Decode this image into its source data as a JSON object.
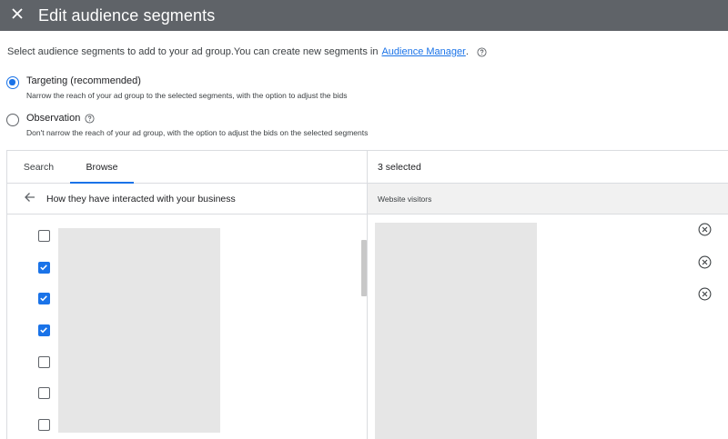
{
  "header": {
    "close_icon": "close-icon",
    "title": "Edit audience segments",
    "background": "#5f6368"
  },
  "intro": {
    "text": "Select audience segments to add to your ad group.You can create new segments in",
    "link": "Audience Manager",
    "suffix": ".",
    "help_icon": "help-icon"
  },
  "options": [
    {
      "label": "Targeting (recommended)",
      "description": "Narrow the reach of your ad group to the selected segments, with the option to adjust the bids",
      "selected": true
    },
    {
      "label": "Observation",
      "description": "Don't narrow the reach of your ad group, with the option to adjust the bids on the selected segments",
      "selected": false
    }
  ],
  "browser": {
    "tabs": [
      {
        "label": "Search",
        "active": false
      },
      {
        "label": "Browse",
        "active": true
      }
    ],
    "back_icon": "arrow-back-icon",
    "category_title": "How they have interacted with your business",
    "checkboxes": [
      false,
      true,
      true,
      true,
      false,
      false,
      false
    ]
  },
  "selection": {
    "count_label": "3 selected",
    "group_title": "Website visitors",
    "remove_icon": "remove-circle-icon",
    "remove_count": 3
  },
  "colors": {
    "accent": "#1a73e8",
    "border": "#dadce0",
    "placeholder": "#e6e6e6",
    "group_header_bg": "#f1f1f1"
  }
}
